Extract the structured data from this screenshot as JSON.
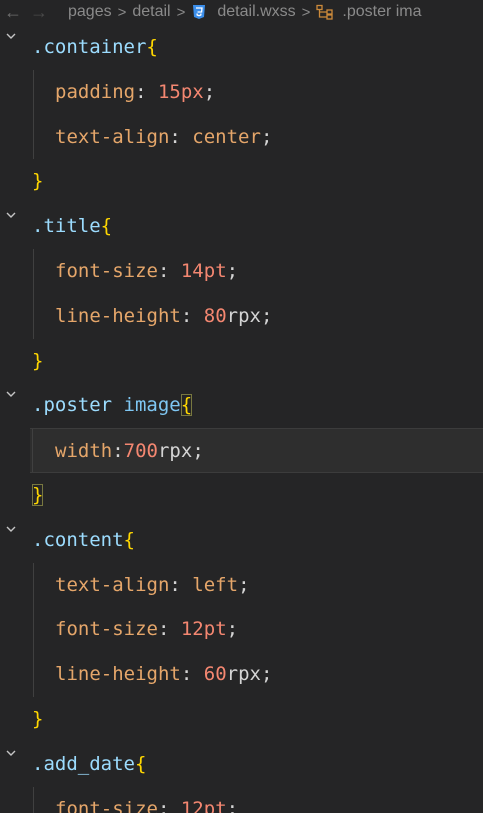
{
  "breadcrumb": {
    "back_icon": "arrow-left-icon",
    "forward_icon": "arrow-right-icon",
    "items": [
      "pages",
      "detail",
      "detail.wxss",
      ".poster ima"
    ],
    "separator": ">",
    "css_icon_color": "#3b8eea",
    "symbol_icon_color": "#cc8a3b"
  },
  "code": {
    "lines": [
      {
        "selector": ".container",
        "open": "{"
      },
      {
        "prop": "padding",
        "colon": ":",
        "value": "15px",
        "semi": ";"
      },
      {
        "prop": "text-align",
        "colon": ":",
        "value": "center",
        "semi": ";"
      },
      {
        "close": "}"
      },
      {
        "selector": ".title",
        "open": "{"
      },
      {
        "prop": "font-size",
        "colon": ":",
        "num": "14",
        "unit": "pt",
        "semi": ";"
      },
      {
        "prop": "line-height",
        "colon": ":",
        "num": "80",
        "unit": "rpx",
        "semi": ";"
      },
      {
        "close": "}"
      },
      {
        "selector": ".poster",
        "selector2": "image",
        "open": "{"
      },
      {
        "prop": "width",
        "colon": ":",
        "num": "700",
        "unit": "rpx",
        "semi": ";"
      },
      {
        "close": "}"
      },
      {
        "selector": ".content",
        "open": "{"
      },
      {
        "prop": "text-align",
        "colon": ":",
        "value": "left",
        "semi": ";"
      },
      {
        "prop": "font-size",
        "colon": ":",
        "num": "12",
        "unit": "pt",
        "semi": ";"
      },
      {
        "prop": "line-height",
        "colon": ":",
        "num": "60",
        "unit": "rpx",
        "semi": ";"
      },
      {
        "close": "}"
      },
      {
        "selector": ".add_date",
        "open": "{"
      },
      {
        "prop": "font-size",
        "colon": ":",
        "num": "12",
        "unit": "pt",
        "semi": ";"
      }
    ]
  }
}
